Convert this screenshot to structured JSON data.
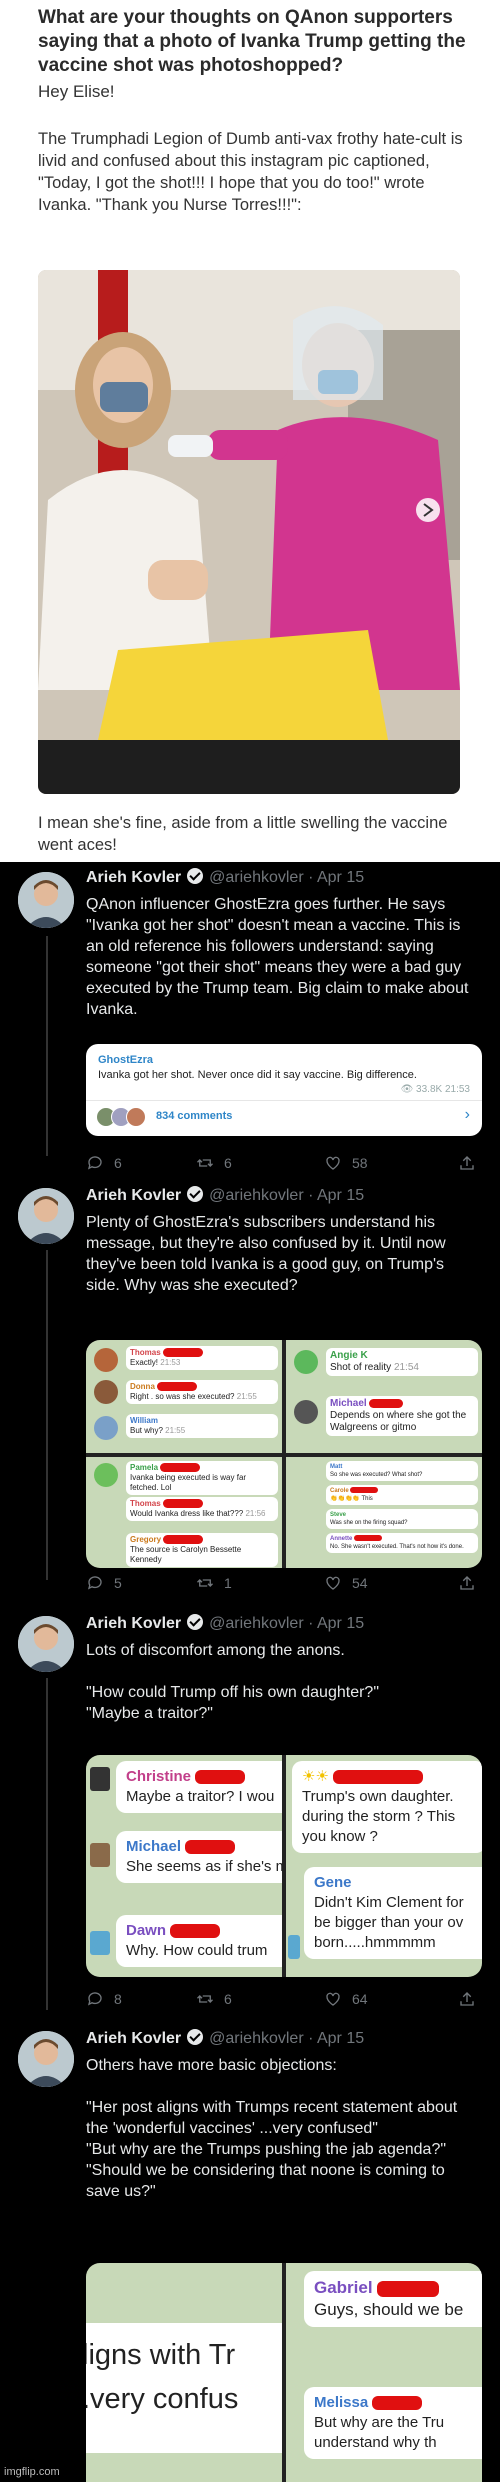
{
  "question": {
    "title": "What are your thoughts on QAnon supporters saying that a photo of Ivanka Trump getting the vaccine shot was photoshopped?",
    "greeting": "Hey Elise!",
    "paragraph": "The Trumphadi Legion of Dumb anti-vax frothy hate-cult is livid and confused about this instagram pic captioned, \"Today, I got the shot!!! I hope that you do too!\" wrote Ivanka. \"Thank you Nurse Torres!!!\":",
    "after": "I mean she's fine, aside from a little swelling the vaccine went aces!"
  },
  "tweets": [
    {
      "name": "Arieh Kovler",
      "handle": "@ariehkovler · Apr 15",
      "text": "QAnon influencer GhostEzra goes further. He says \"Ivanka got her shot\" doesn't mean a vaccine. This is an old reference his followers understand: saying someone \"got their shot\" means they were a bad guy executed by the Trump team. Big claim to make about Ivanka.",
      "replies": "6",
      "retweets": "6",
      "likes": "58",
      "card": {
        "channel": "GhostEzra",
        "message": "Ivanka got her shot. Never once did it say vaccine. Big difference.",
        "views": "33.8K",
        "time": "21:53",
        "comments": "834 comments"
      }
    },
    {
      "name": "Arieh Kovler",
      "handle": "@ariehkovler · Apr 15",
      "text": "Plenty of GhostEzra's subscribers understand his message, but they're also confused by it. Until now they've been told Ivanka is a good guy, on Trump's side. Why was she executed?",
      "replies": "5",
      "retweets": "1",
      "likes": "54",
      "chat": [
        {
          "who": "Thomas",
          "text": "Exactly!",
          "time": "21:53"
        },
        {
          "who": "Donna",
          "text": "Right . so was she executed?",
          "time": "21:55"
        },
        {
          "who": "William",
          "text": "But why?",
          "time": "21:55"
        },
        {
          "who": "Angie K",
          "text": "Shot of reality",
          "time": "21:54"
        },
        {
          "who": "Michael",
          "text": "Depends on where she got the Walgreens or gitmo",
          "time": ""
        },
        {
          "who": "Pamela",
          "text": "Ivanka being executed is way far fetched. Lol",
          "time": ""
        },
        {
          "who": "Thomas",
          "text": "Would Ivanka dress like that???",
          "time": "21:56"
        },
        {
          "who": "Gregory",
          "text": "The source is Carolyn Bessette Kennedy",
          "time": ""
        },
        {
          "who": "Matt",
          "text": "So she was executed? What shot?",
          "time": ""
        },
        {
          "who": "Carole",
          "text": "👏👏👏👏 This",
          "time": ""
        },
        {
          "who": "Steve",
          "text": "Was she on the firing squad?",
          "time": ""
        },
        {
          "who": "Annette",
          "text": "No. She wasn't executed. That's not how it's done.",
          "time": ""
        }
      ]
    },
    {
      "name": "Arieh Kovler",
      "handle": "@ariehkovler · Apr 15",
      "text": "Lots of discomfort among the anons.\n\n\"How could Trump off his own daughter?\"\n\"Maybe a traitor?\"",
      "replies": "8",
      "retweets": "6",
      "likes": "64",
      "chat": [
        {
          "who": "Christine",
          "text": "Maybe a traitor? I wou"
        },
        {
          "who": "Michael",
          "text": "She seems as if she's m we know Jr's role has be"
        },
        {
          "who": "Dawn",
          "text": "Why.  How could trum"
        },
        {
          "who": "",
          "text": "Trump's own daughter. during the storm ? This you know ?"
        },
        {
          "who": "Gene",
          "text": "Didn't Kim Clement for be bigger than your ov born.....hmmmmm"
        }
      ]
    },
    {
      "name": "Arieh Kovler",
      "handle": "@ariehkovler · Apr 15",
      "text": "Others have more basic objections:\n\n\"Her post aligns with Trumps recent statement about the 'wonderful vaccines' ...very confused\"\n\"But why are the Trumps pushing the jab agenda?\"\n\"Should we be considering that noone is coming to save us?\"",
      "chat": [
        {
          "line1": "ligns with Tr",
          "line2": ".very confus"
        },
        {
          "who": "Gabriel",
          "text": "Guys, should we be"
        },
        {
          "who": "Melissa",
          "text": "But why are the Tru understand why th"
        }
      ]
    }
  ],
  "watermark": "imgflip.com"
}
